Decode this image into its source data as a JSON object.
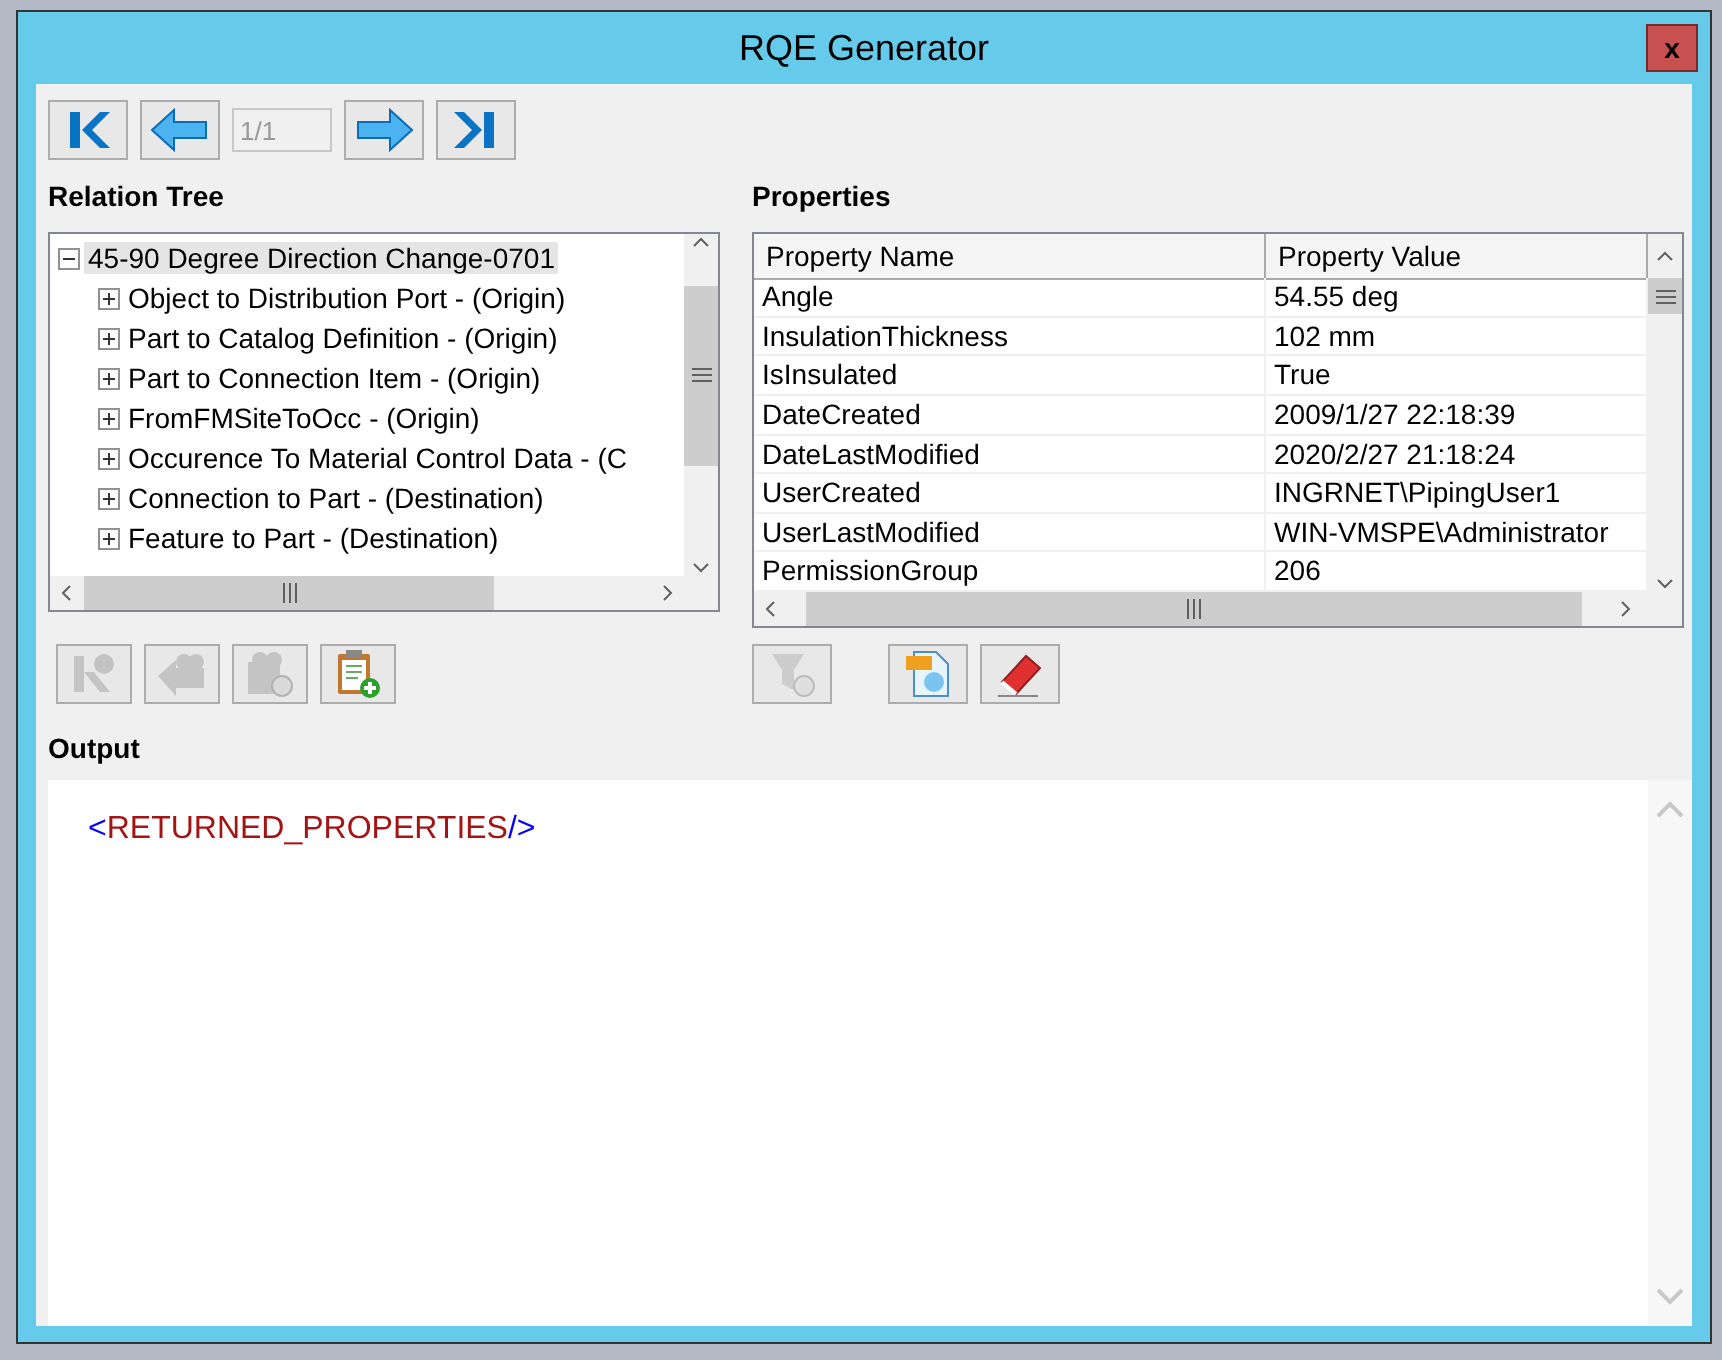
{
  "window": {
    "title": "RQE Generator",
    "close_label": "x"
  },
  "navigator": {
    "page": "1/1",
    "buttons": [
      {
        "kind": "first"
      },
      {
        "kind": "prev"
      },
      {
        "kind": "next"
      },
      {
        "kind": "last"
      }
    ]
  },
  "relation_tree": {
    "title": "Relation Tree",
    "root": {
      "label": "45-90 Degree Direction Change-0701",
      "expanded": true,
      "selected": true,
      "children": [
        {
          "label": "Object to Distribution Port - (Origin)",
          "expanded": false
        },
        {
          "label": "Part to Catalog Definition - (Origin)",
          "expanded": false
        },
        {
          "label": "Part to Connection Item - (Origin)",
          "expanded": false
        },
        {
          "label": "FromFMSiteToOcc - (Origin)",
          "expanded": false
        },
        {
          "label": "Occurence To Material Control Data - (C",
          "expanded": false
        },
        {
          "label": "Connection to Part - (Destination)",
          "expanded": false
        },
        {
          "label": "Feature to Part - (Destination)",
          "expanded": false
        }
      ]
    },
    "tools": [
      {
        "kind": "relation",
        "disabled": true
      },
      {
        "kind": "back",
        "disabled": true
      },
      {
        "kind": "query",
        "disabled": true
      },
      {
        "kind": "clipboard",
        "disabled": false
      }
    ]
  },
  "properties": {
    "title": "Properties",
    "columns": [
      "Property Name",
      "Property Value"
    ],
    "rows": [
      [
        "Angle",
        "54.55 deg"
      ],
      [
        "InsulationThickness",
        "102 mm"
      ],
      [
        "IsInsulated",
        "True"
      ],
      [
        "DateCreated",
        "2009/1/27 22:18:39"
      ],
      [
        "DateLastModified",
        "2020/2/27 21:18:24"
      ],
      [
        "UserCreated",
        "INGRNET\\PipingUser1"
      ],
      [
        "UserLastModified",
        "WIN-VMSPE\\Administrator"
      ],
      [
        "PermissionGroup",
        "206"
      ]
    ],
    "tools": [
      {
        "kind": "filter",
        "disabled": true
      },
      {
        "kind": "xml",
        "disabled": false
      },
      {
        "kind": "eraser",
        "disabled": false
      }
    ]
  },
  "output": {
    "title": "Output",
    "parts": [
      {
        "kind": "bracket",
        "text": "<"
      },
      {
        "kind": "tag",
        "text": "RETURNED_PROPERTIES"
      },
      {
        "kind": "bracket",
        "text": "/>"
      }
    ]
  }
}
